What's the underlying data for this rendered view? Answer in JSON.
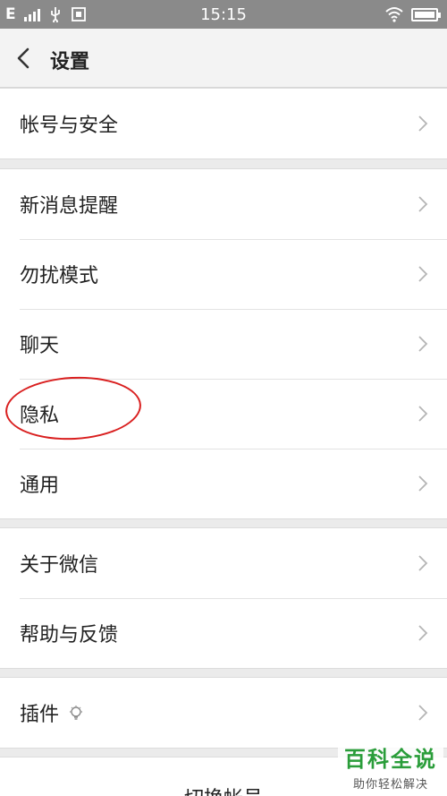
{
  "status_bar": {
    "carrier": "E",
    "time": "15:15"
  },
  "header": {
    "title": "设置"
  },
  "sections": [
    {
      "items": [
        {
          "label": "帐号与安全"
        }
      ]
    },
    {
      "items": [
        {
          "label": "新消息提醒"
        },
        {
          "label": "勿扰模式"
        },
        {
          "label": "聊天"
        },
        {
          "label": "隐私"
        },
        {
          "label": "通用"
        }
      ]
    },
    {
      "items": [
        {
          "label": "关于微信"
        },
        {
          "label": "帮助与反馈"
        }
      ]
    },
    {
      "items": [
        {
          "label": "插件"
        }
      ]
    }
  ],
  "switch_account": {
    "label": "切换帐号"
  },
  "watermark": {
    "title": "百科全说",
    "subtitle": "助你轻松解决"
  },
  "colors": {
    "annotation": "#d91f1f",
    "watermark_green": "#2a9d3a"
  }
}
